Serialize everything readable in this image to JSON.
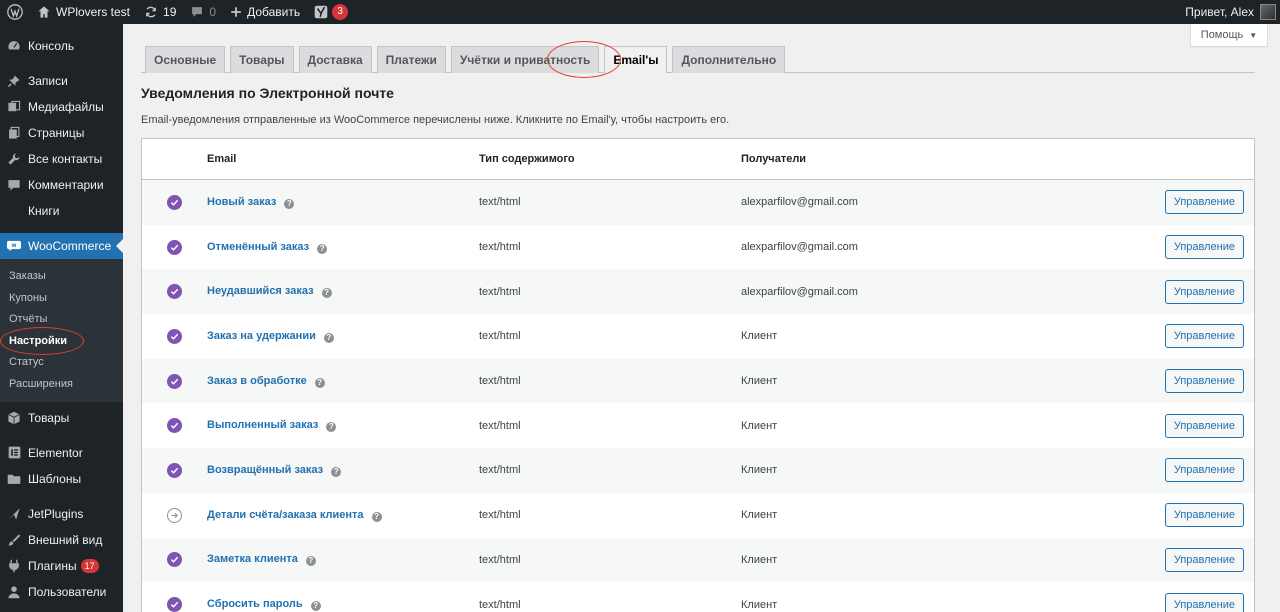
{
  "admin_bar": {
    "site_name": "WPlovers test",
    "updates_count": "19",
    "comments_count": "0",
    "add_new_label": "Добавить",
    "yoast_count": "3",
    "greeting": "Привет, Alex"
  },
  "help_button": {
    "label": "Помощь"
  },
  "sidebar": {
    "items_top": [
      {
        "label": "Консоль",
        "icon": "dashboard-icon"
      },
      {
        "label": "Записи",
        "icon": "pin-icon"
      },
      {
        "label": "Медиафайлы",
        "icon": "media-icon"
      },
      {
        "label": "Страницы",
        "icon": "pages-icon"
      },
      {
        "label": "Все контакты",
        "icon": "wrench-icon"
      },
      {
        "label": "Комментарии",
        "icon": "comment-icon"
      },
      {
        "label": "Книги",
        "icon": ""
      }
    ],
    "current": {
      "label": "WooCommerce",
      "icon": "woo-icon"
    },
    "submenu": [
      "Заказы",
      "Купоны",
      "Отчёты",
      "Настройки",
      "Статус",
      "Расширения"
    ],
    "items_bottom": [
      {
        "label": "Товары",
        "icon": "box-icon"
      },
      {
        "label": "Elementor",
        "icon": "elementor-icon"
      },
      {
        "label": "Шаблоны",
        "icon": "folder-icon"
      },
      {
        "label": "JetPlugins",
        "icon": "jet-icon"
      },
      {
        "label": "Внешний вид",
        "icon": "brush-icon"
      },
      {
        "label": "Плагины",
        "icon": "plugin-icon",
        "badge": "17"
      },
      {
        "label": "Пользователи",
        "icon": "user-icon"
      }
    ]
  },
  "tabs": [
    "Основные",
    "Товары",
    "Доставка",
    "Платежи",
    "Учётки и приватность",
    "Email'ы",
    "Дополнительно"
  ],
  "active_tab": "Email'ы",
  "page": {
    "title": "Уведомления по Электронной почте",
    "description": "Email-уведомления отправленные из WooCommerce перечислены ниже. Кликните по Email'у, чтобы настроить его."
  },
  "table": {
    "headers": {
      "email": "Email",
      "type": "Тип содержимого",
      "recipients": "Получатели"
    },
    "rows": [
      {
        "name": "Новый заказ",
        "type": "text/html",
        "recipient": "alexparfilov@gmail.com",
        "status": "enabled",
        "action": "Управление"
      },
      {
        "name": "Отменённый заказ",
        "type": "text/html",
        "recipient": "alexparfilov@gmail.com",
        "status": "enabled",
        "action": "Управление"
      },
      {
        "name": "Неудавшийся заказ",
        "type": "text/html",
        "recipient": "alexparfilov@gmail.com",
        "status": "enabled",
        "action": "Управление"
      },
      {
        "name": "Заказ на удержании",
        "type": "text/html",
        "recipient": "Клиент",
        "status": "enabled",
        "action": "Управление"
      },
      {
        "name": "Заказ в обработке",
        "type": "text/html",
        "recipient": "Клиент",
        "status": "enabled",
        "action": "Управление"
      },
      {
        "name": "Выполненный заказ",
        "type": "text/html",
        "recipient": "Клиент",
        "status": "enabled",
        "action": "Управление"
      },
      {
        "name": "Возвращённый заказ",
        "type": "text/html",
        "recipient": "Клиент",
        "status": "enabled",
        "action": "Управление"
      },
      {
        "name": "Детали счёта/заказа клиента",
        "type": "text/html",
        "recipient": "Клиент",
        "status": "manual",
        "action": "Управление"
      },
      {
        "name": "Заметка клиента",
        "type": "text/html",
        "recipient": "Клиент",
        "status": "enabled",
        "action": "Управление"
      },
      {
        "name": "Сбросить пароль",
        "type": "text/html",
        "recipient": "Клиент",
        "status": "enabled",
        "action": "Управление"
      }
    ]
  },
  "colors": {
    "admin_dark": "#1d2327",
    "wp_blue": "#2271b1",
    "woo_purple": "#7f54b3",
    "annotation_red": "#e2402d"
  }
}
